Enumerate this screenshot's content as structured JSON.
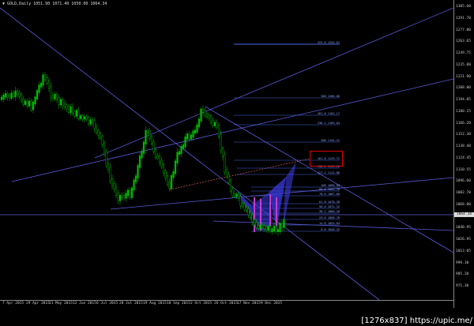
{
  "window": {
    "title": "▼ GOLD,Daily  1051.90 1071.40 1050.00 1064.34"
  },
  "price_axis": {
    "labels": [
      "1305.60",
      "1291.70",
      "1277.80",
      "1263.65",
      "1249.75",
      "1235.80",
      "1221.90",
      "1208.00",
      "1194.05",
      "1180.15",
      "1166.20",
      "1152.30",
      "1138.40",
      "1124.45",
      "1110.55",
      "1096.60",
      "1082.70",
      "1068.80",
      "1054.85",
      "1040.95",
      "1026.95",
      "1013.05",
      "999.10",
      "985.20",
      "971.30"
    ],
    "current_price": "1064.34",
    "tag_color": "#dddddd"
  },
  "time_axis": {
    "labels": [
      "7 Apr 2015",
      "29 Apr 2015",
      "21 May 2015",
      "12 Jun 2015",
      "6 Jul 2015",
      "28 Jul 2015",
      "19 Aug 2015",
      "10 Sep 2015",
      "2 Oct 2015",
      "26 Oct 2015",
      "17 Nov 2015",
      "9 Dec 2015"
    ]
  },
  "fibo_levels": [
    {
      "label": "423.6  1254.01"
    },
    {
      "label": "300  1200.00"
    },
    {
      "label": "261.8  1181.17"
    },
    {
      "label": "236.2  1169.04"
    },
    {
      "label": "200  1144.41"
    },
    {
      "label": "161.8  1129.72"
    },
    {
      "label": "138.2  1119.20"
    },
    {
      "label": "127.2  1112.86"
    },
    {
      "label": "100  1096.03"
    },
    {
      "label": "88.6  1092.20"
    },
    {
      "label": "78.6  1087.00"
    },
    {
      "label": "61.8  1078.38"
    },
    {
      "label": "50.0  1072.32"
    },
    {
      "label": "38.2  1066.26"
    },
    {
      "label": "23.6  1058.78"
    },
    {
      "label": "14.6  1055.84"
    },
    {
      "label": "0.0  1046.42"
    }
  ],
  "colors": {
    "background": "#000000",
    "candle_up": "#00c000",
    "candle_down": "#00c000",
    "channel_line": "#5a5ad8",
    "fibo": "#4a6ae0",
    "pattern_fill": "#3a3ae0",
    "pattern_leg": "#c83ad0",
    "trend_dashed": "#c05050",
    "highlight_box": "#e00000"
  },
  "watermark": "[1276x837] https://upic.me/"
}
